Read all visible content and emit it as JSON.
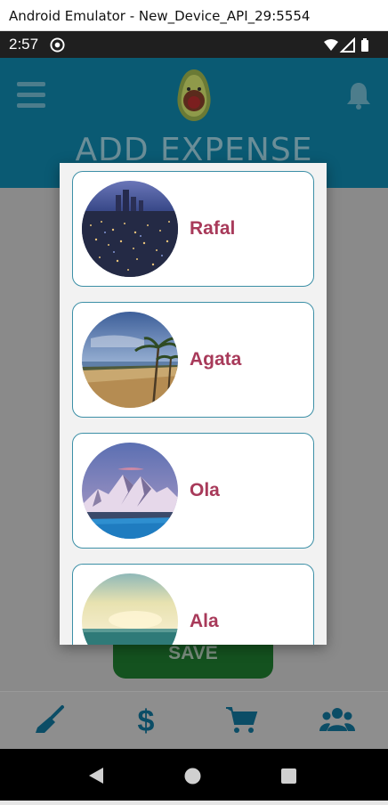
{
  "window": {
    "title": "Android Emulator - New_Device_API_29:5554"
  },
  "status_bar": {
    "time": "2:57"
  },
  "header": {
    "title": "ADD EXPENSE"
  },
  "form": {
    "save_label": "SAVE"
  },
  "dialog": {
    "people": [
      {
        "name": "Rafal",
        "photo": "city-night-photo"
      },
      {
        "name": "Agata",
        "photo": "tropical-beach-photo"
      },
      {
        "name": "Ola",
        "photo": "snowy-mountain-photo"
      },
      {
        "name": "Ala",
        "photo": "ocean-sunset-photo"
      }
    ]
  },
  "bottom_nav": {
    "items": [
      {
        "icon": "broom-icon"
      },
      {
        "icon": "dollar-icon"
      },
      {
        "icon": "cart-icon"
      },
      {
        "icon": "group-icon"
      }
    ]
  },
  "colors": {
    "header": "#0a5a73",
    "card_border": "#3c8fa6",
    "name_text": "#a83a5a",
    "save_button": "#14521f"
  }
}
